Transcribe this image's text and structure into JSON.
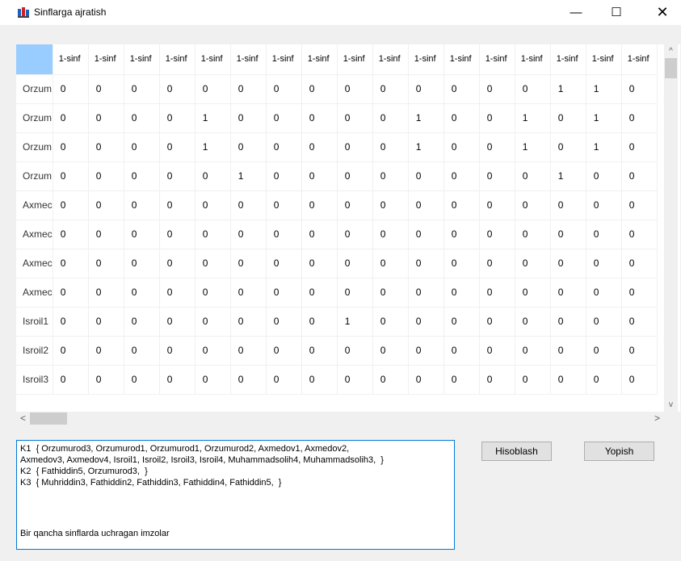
{
  "window": {
    "title": "Sinflarga ajratish",
    "minimize": "—",
    "maximize": "☐",
    "close": "✕"
  },
  "grid": {
    "column_headers": [
      "1-sinf",
      "1-sinf",
      "1-sinf",
      "1-sinf",
      "1-sinf",
      "1-sinf",
      "1-sinf",
      "1-sinf",
      "1-sinf",
      "1-sinf",
      "1-sinf",
      "1-sinf",
      "1-sinf",
      "1-sinf",
      "1-sinf",
      "1-sinf",
      "1-sinf"
    ],
    "rows": [
      {
        "label": "Orzum",
        "values": [
          "0",
          "0",
          "0",
          "0",
          "0",
          "0",
          "0",
          "0",
          "0",
          "0",
          "0",
          "0",
          "0",
          "0",
          "1",
          "1",
          "0"
        ]
      },
      {
        "label": "Orzum",
        "values": [
          "0",
          "0",
          "0",
          "0",
          "1",
          "0",
          "0",
          "0",
          "0",
          "0",
          "1",
          "0",
          "0",
          "1",
          "0",
          "1",
          "0"
        ]
      },
      {
        "label": "Orzum",
        "values": [
          "0",
          "0",
          "0",
          "0",
          "1",
          "0",
          "0",
          "0",
          "0",
          "0",
          "1",
          "0",
          "0",
          "1",
          "0",
          "1",
          "0"
        ]
      },
      {
        "label": "Orzum",
        "values": [
          "0",
          "0",
          "0",
          "0",
          "0",
          "1",
          "0",
          "0",
          "0",
          "0",
          "0",
          "0",
          "0",
          "0",
          "1",
          "0",
          "0"
        ]
      },
      {
        "label": "Axmec",
        "values": [
          "0",
          "0",
          "0",
          "0",
          "0",
          "0",
          "0",
          "0",
          "0",
          "0",
          "0",
          "0",
          "0",
          "0",
          "0",
          "0",
          "0"
        ]
      },
      {
        "label": "Axmec",
        "values": [
          "0",
          "0",
          "0",
          "0",
          "0",
          "0",
          "0",
          "0",
          "0",
          "0",
          "0",
          "0",
          "0",
          "0",
          "0",
          "0",
          "0"
        ]
      },
      {
        "label": "Axmec",
        "values": [
          "0",
          "0",
          "0",
          "0",
          "0",
          "0",
          "0",
          "0",
          "0",
          "0",
          "0",
          "0",
          "0",
          "0",
          "0",
          "0",
          "0"
        ]
      },
      {
        "label": "Axmec",
        "values": [
          "0",
          "0",
          "0",
          "0",
          "0",
          "0",
          "0",
          "0",
          "0",
          "0",
          "0",
          "0",
          "0",
          "0",
          "0",
          "0",
          "0"
        ]
      },
      {
        "label": "Isroil1",
        "values": [
          "0",
          "0",
          "0",
          "0",
          "0",
          "0",
          "0",
          "0",
          "1",
          "0",
          "0",
          "0",
          "0",
          "0",
          "0",
          "0",
          "0"
        ]
      },
      {
        "label": "Isroil2",
        "values": [
          "0",
          "0",
          "0",
          "0",
          "0",
          "0",
          "0",
          "0",
          "0",
          "0",
          "0",
          "0",
          "0",
          "0",
          "0",
          "0",
          "0"
        ]
      },
      {
        "label": "Isroil3",
        "values": [
          "0",
          "0",
          "0",
          "0",
          "0",
          "0",
          "0",
          "0",
          "0",
          "0",
          "0",
          "0",
          "0",
          "0",
          "0",
          "0",
          "0"
        ]
      }
    ]
  },
  "scrollbars": {
    "up_arrow": "^",
    "down_arrow": "v",
    "left_arrow": "<",
    "right_arrow": ">"
  },
  "result": {
    "lines": [
      "K1  { Orzumurod3, Orzumurod1, Orzumurod1, Orzumurod2, Axmedov1, Axmedov2,",
      "Axmedov3, Axmedov4, Isroil1, Isroil2, Isroil3, Isroil4, Muhammadsolih4, Muhammadsolih3,  }",
      "K2  { Fathiddin5, Orzumurod3,  }",
      "K3  { Muhriddin3, Fathiddin2, Fathiddin3, Fathiddin4, Fathiddin5,  }"
    ],
    "note": "Bir qancha sinflarda uchragan imzolar"
  },
  "buttons": {
    "calculate": "Hisoblash",
    "close": "Yopish"
  },
  "colors": {
    "corner_cell": "#99ccff",
    "focus_border": "#0078d7",
    "app_icon_blue": "#1f5fbf",
    "app_icon_red": "#d02020"
  }
}
